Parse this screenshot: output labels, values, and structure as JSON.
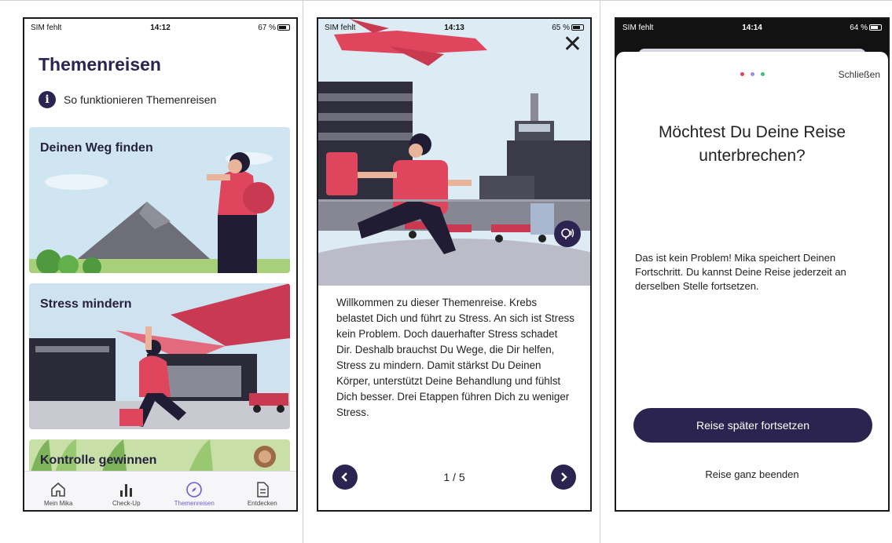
{
  "status_bars": [
    {
      "carrier": "SIM fehlt",
      "time": "14:12",
      "battery": "67 %",
      "battery_level": 0.67
    },
    {
      "carrier": "SIM fehlt",
      "time": "14:13",
      "battery": "65 %",
      "battery_level": 0.65
    },
    {
      "carrier": "SIM fehlt",
      "time": "14:14",
      "battery": "64 %",
      "battery_level": 0.64
    }
  ],
  "screen1": {
    "title": "Themenreisen",
    "info_link": "So funktionieren Themenreisen",
    "cards": [
      {
        "title": "Deinen Weg finden"
      },
      {
        "title": "Stress mindern"
      },
      {
        "title": "Kontrolle gewinnen"
      }
    ],
    "tabs": [
      {
        "label": "Mein Mika",
        "icon": "home-icon"
      },
      {
        "label": "Check-Up",
        "icon": "bar-chart-icon"
      },
      {
        "label": "Themenreisen",
        "icon": "compass-icon",
        "active": true
      },
      {
        "label": "Entdecken",
        "icon": "document-icon"
      }
    ],
    "active_color": "#6b5cd6"
  },
  "screen2": {
    "body": "Willkommen zu dieser Themenreise. Krebs belastet Dich und führt zu Stress. An sich ist Stress kein Problem. Doch dauerhafter Stress schadet Dir. Deshalb brauchst Du Wege, die Dir helfen, Stress zu mindern. Damit stärkst Du Deinen Körper, unterstützt Deine Behandlung und fühlst Dich besser. Drei Etappen führen Dich zu weniger Stress.",
    "pager": "1 / 5"
  },
  "screen3": {
    "close_label": "Schließen",
    "heading": "Möchtest Du Deine Reise unterbrechen?",
    "body": "Das ist kein Problem! Mika speichert Deinen Fortschritt. Du kannst Deine Reise jederzeit an derselben Stelle fortsetzen.",
    "primary_button": "Reise später fortsetzen",
    "secondary_button": "Reise ganz beenden",
    "dot_colors": [
      "#d9475f",
      "#9b8fe0",
      "#3fbf7f"
    ]
  },
  "colors": {
    "brand": "#2b2350",
    "accent": "#e0455e"
  }
}
